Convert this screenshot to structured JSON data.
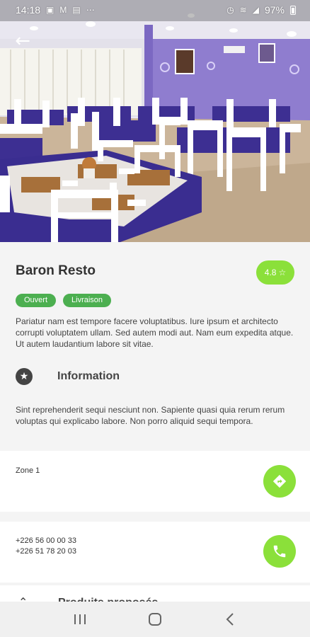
{
  "status_bar": {
    "time": "14:18",
    "battery": "97%",
    "left_icons": [
      "image-icon",
      "gmail-icon",
      "gallery-icon",
      "more-icon"
    ],
    "right_icons": [
      "alarm-icon",
      "wifi-icon",
      "signal-icon",
      "battery-icon"
    ]
  },
  "hero": {
    "image": "restaurant-dining-room-photo",
    "colors": {
      "wall": "#9b8bd4",
      "tablecloth": "#3c2f8f",
      "chairs": "#ffffff",
      "floor": "#c8b49a"
    }
  },
  "restaurant": {
    "name": "Baron Resto",
    "rating": "4.8",
    "tags": [
      "Ouvert",
      "Livraison"
    ],
    "description": "Pariatur nam est tempore facere voluptatibus. Iure ipsum et architecto corrupti voluptatem ullam. Sed autem modi aut. Nam eum expedita atque. Ut autem laudantium labore sit vitae."
  },
  "information": {
    "title": "Information",
    "text": "Sint reprehenderit sequi nesciunt non. Sapiente quasi quia rerum rerum voluptas qui explicabo labore. Non porro aliquid sequi tempora."
  },
  "location": {
    "zone": "Zone 1"
  },
  "contact": {
    "phone1": "+226 56 00 00 33",
    "phone2": "+226 51 78 20 03"
  },
  "products": {
    "title": "Produits proposés"
  },
  "colors": {
    "accent": "#8be03a",
    "tag": "#4caf50",
    "text": "#333333"
  }
}
